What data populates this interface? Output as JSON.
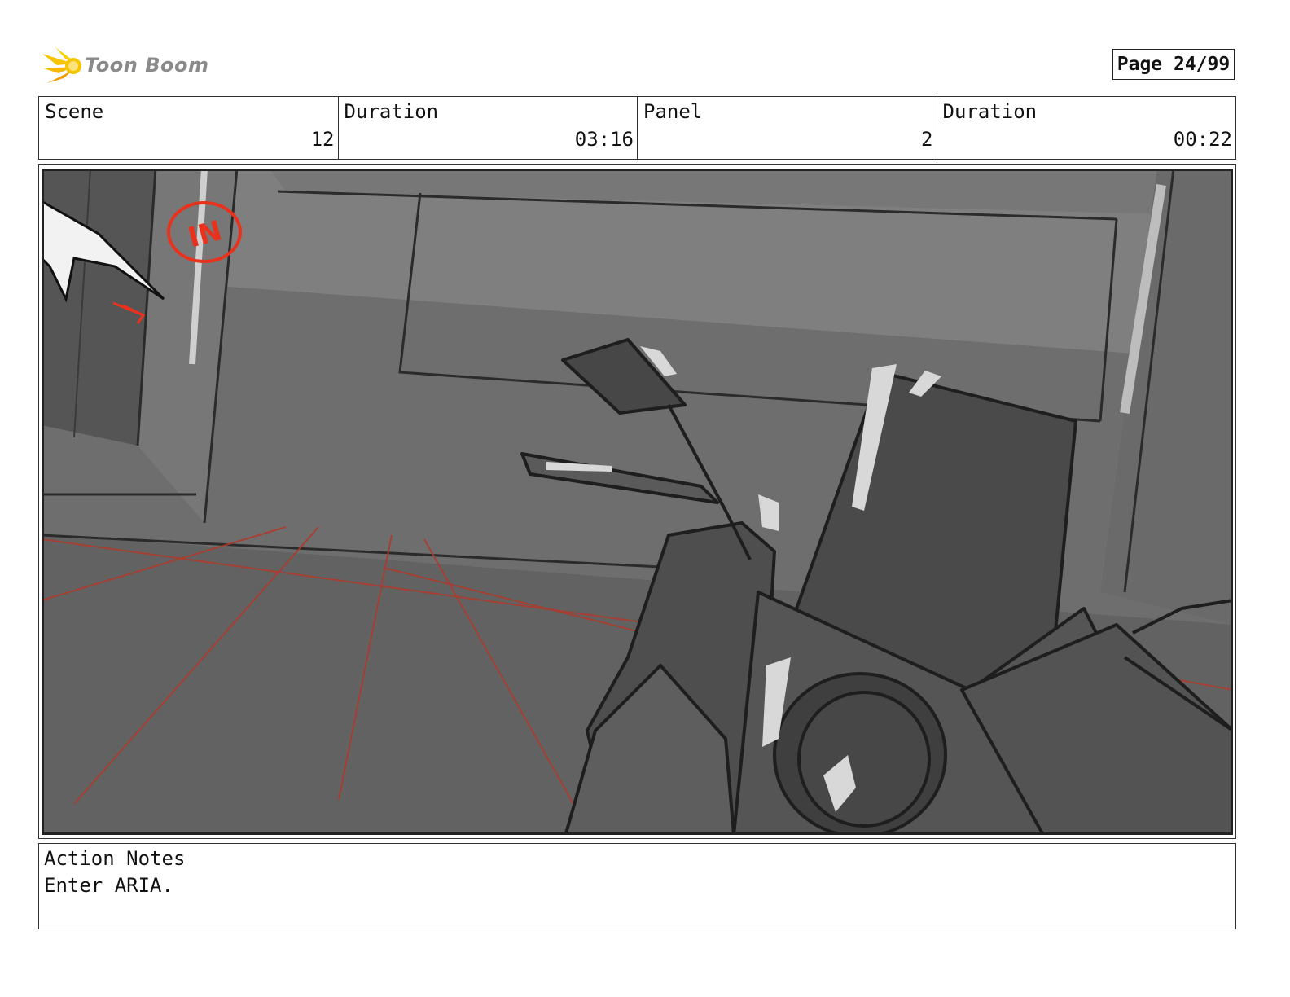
{
  "header": {
    "brand": "Toon Boom",
    "page_label": "Page 24/99"
  },
  "info": {
    "scene_label": "Scene",
    "scene_value": "12",
    "scene_duration_label": "Duration",
    "scene_duration_value": "03:16",
    "panel_label": "Panel",
    "panel_value": "2",
    "panel_duration_label": "Duration",
    "panel_duration_value": "00:22"
  },
  "panel": {
    "annotation_text": "IN",
    "annotation_color": "#e8321e"
  },
  "notes": {
    "label": "Action Notes",
    "text": "Enter ARIA."
  },
  "colors": {
    "brand_yellow": "#f6c500",
    "brand_orange": "#f29a00",
    "sketch_red": "#c0392b",
    "panel_gray": "#6b6b6b"
  }
}
